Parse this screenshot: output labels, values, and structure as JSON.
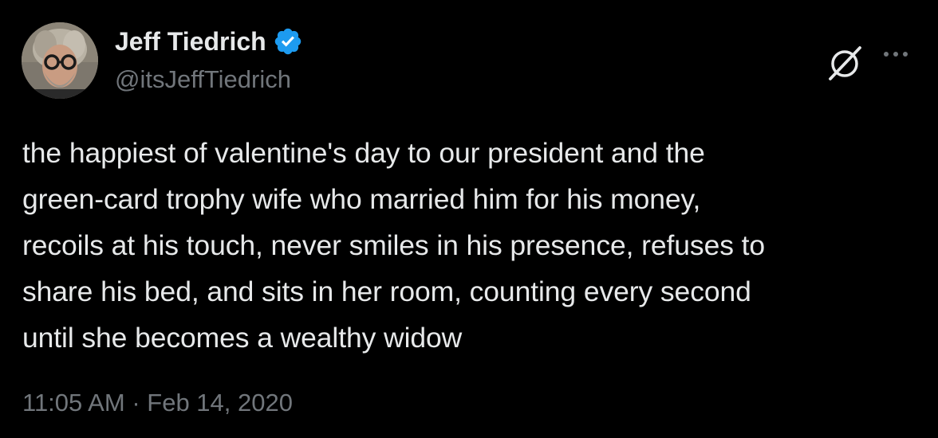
{
  "author": {
    "name": "Jeff Tiedrich",
    "handle": "@itsJeffTiedrich",
    "verified": true,
    "avatar_icon": "profile-photo"
  },
  "actions": {
    "grok_icon": "grok-icon",
    "more_icon": "more-options-icon"
  },
  "tweet": {
    "text": "the happiest of valentine's day to our president and the\ngreen-card trophy wife who married him for his money,\nrecoils at his touch, never smiles in his presence, refuses to\nshare his bed, and sits in her room, counting every second\nuntil she becomes a wealthy widow",
    "time": "11:05 AM",
    "separator": "·",
    "date": "Feb 14, 2020"
  },
  "colors": {
    "background": "#000000",
    "text_primary": "#e7e9ea",
    "text_secondary": "#71767b",
    "verified_blue": "#1d9bf0"
  }
}
